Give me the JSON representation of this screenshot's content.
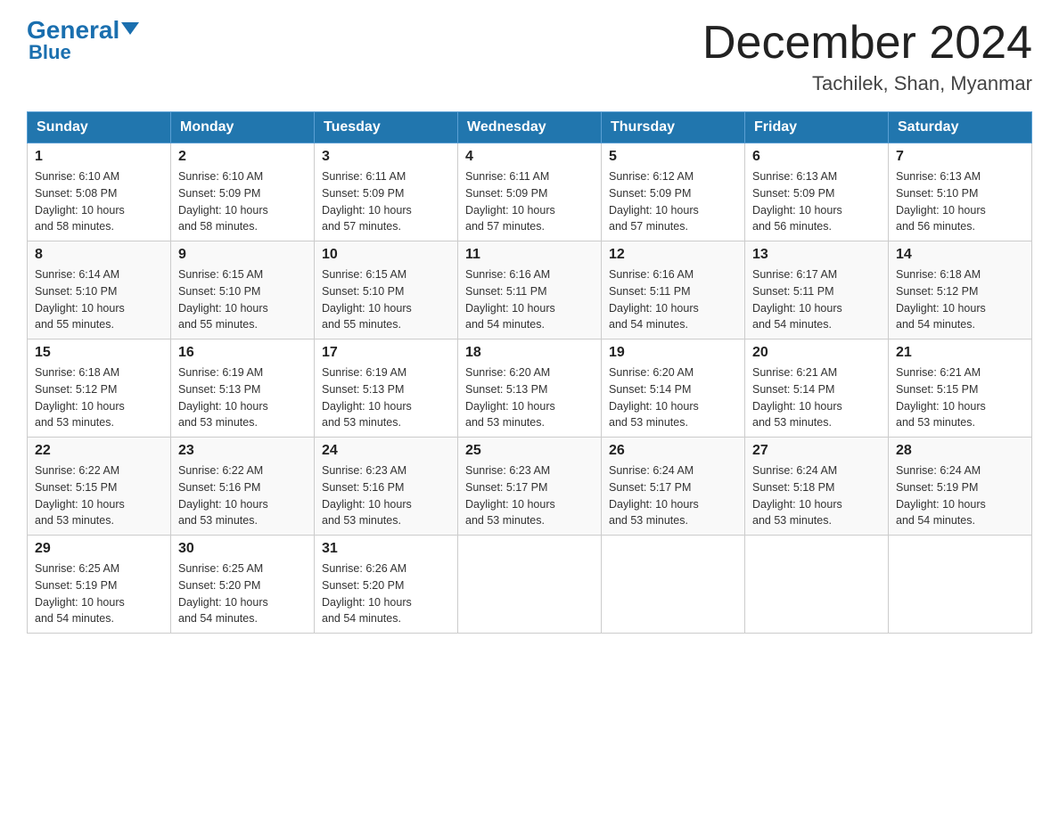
{
  "header": {
    "logo_general": "General",
    "logo_blue": "Blue",
    "month_title": "December 2024",
    "location": "Tachilek, Shan, Myanmar"
  },
  "days_of_week": [
    "Sunday",
    "Monday",
    "Tuesday",
    "Wednesday",
    "Thursday",
    "Friday",
    "Saturday"
  ],
  "weeks": [
    [
      {
        "num": "1",
        "sunrise": "6:10 AM",
        "sunset": "5:08 PM",
        "daylight": "10 hours and 58 minutes."
      },
      {
        "num": "2",
        "sunrise": "6:10 AM",
        "sunset": "5:09 PM",
        "daylight": "10 hours and 58 minutes."
      },
      {
        "num": "3",
        "sunrise": "6:11 AM",
        "sunset": "5:09 PM",
        "daylight": "10 hours and 57 minutes."
      },
      {
        "num": "4",
        "sunrise": "6:11 AM",
        "sunset": "5:09 PM",
        "daylight": "10 hours and 57 minutes."
      },
      {
        "num": "5",
        "sunrise": "6:12 AM",
        "sunset": "5:09 PM",
        "daylight": "10 hours and 57 minutes."
      },
      {
        "num": "6",
        "sunrise": "6:13 AM",
        "sunset": "5:09 PM",
        "daylight": "10 hours and 56 minutes."
      },
      {
        "num": "7",
        "sunrise": "6:13 AM",
        "sunset": "5:10 PM",
        "daylight": "10 hours and 56 minutes."
      }
    ],
    [
      {
        "num": "8",
        "sunrise": "6:14 AM",
        "sunset": "5:10 PM",
        "daylight": "10 hours and 55 minutes."
      },
      {
        "num": "9",
        "sunrise": "6:15 AM",
        "sunset": "5:10 PM",
        "daylight": "10 hours and 55 minutes."
      },
      {
        "num": "10",
        "sunrise": "6:15 AM",
        "sunset": "5:10 PM",
        "daylight": "10 hours and 55 minutes."
      },
      {
        "num": "11",
        "sunrise": "6:16 AM",
        "sunset": "5:11 PM",
        "daylight": "10 hours and 54 minutes."
      },
      {
        "num": "12",
        "sunrise": "6:16 AM",
        "sunset": "5:11 PM",
        "daylight": "10 hours and 54 minutes."
      },
      {
        "num": "13",
        "sunrise": "6:17 AM",
        "sunset": "5:11 PM",
        "daylight": "10 hours and 54 minutes."
      },
      {
        "num": "14",
        "sunrise": "6:18 AM",
        "sunset": "5:12 PM",
        "daylight": "10 hours and 54 minutes."
      }
    ],
    [
      {
        "num": "15",
        "sunrise": "6:18 AM",
        "sunset": "5:12 PM",
        "daylight": "10 hours and 53 minutes."
      },
      {
        "num": "16",
        "sunrise": "6:19 AM",
        "sunset": "5:13 PM",
        "daylight": "10 hours and 53 minutes."
      },
      {
        "num": "17",
        "sunrise": "6:19 AM",
        "sunset": "5:13 PM",
        "daylight": "10 hours and 53 minutes."
      },
      {
        "num": "18",
        "sunrise": "6:20 AM",
        "sunset": "5:13 PM",
        "daylight": "10 hours and 53 minutes."
      },
      {
        "num": "19",
        "sunrise": "6:20 AM",
        "sunset": "5:14 PM",
        "daylight": "10 hours and 53 minutes."
      },
      {
        "num": "20",
        "sunrise": "6:21 AM",
        "sunset": "5:14 PM",
        "daylight": "10 hours and 53 minutes."
      },
      {
        "num": "21",
        "sunrise": "6:21 AM",
        "sunset": "5:15 PM",
        "daylight": "10 hours and 53 minutes."
      }
    ],
    [
      {
        "num": "22",
        "sunrise": "6:22 AM",
        "sunset": "5:15 PM",
        "daylight": "10 hours and 53 minutes."
      },
      {
        "num": "23",
        "sunrise": "6:22 AM",
        "sunset": "5:16 PM",
        "daylight": "10 hours and 53 minutes."
      },
      {
        "num": "24",
        "sunrise": "6:23 AM",
        "sunset": "5:16 PM",
        "daylight": "10 hours and 53 minutes."
      },
      {
        "num": "25",
        "sunrise": "6:23 AM",
        "sunset": "5:17 PM",
        "daylight": "10 hours and 53 minutes."
      },
      {
        "num": "26",
        "sunrise": "6:24 AM",
        "sunset": "5:17 PM",
        "daylight": "10 hours and 53 minutes."
      },
      {
        "num": "27",
        "sunrise": "6:24 AM",
        "sunset": "5:18 PM",
        "daylight": "10 hours and 53 minutes."
      },
      {
        "num": "28",
        "sunrise": "6:24 AM",
        "sunset": "5:19 PM",
        "daylight": "10 hours and 54 minutes."
      }
    ],
    [
      {
        "num": "29",
        "sunrise": "6:25 AM",
        "sunset": "5:19 PM",
        "daylight": "10 hours and 54 minutes."
      },
      {
        "num": "30",
        "sunrise": "6:25 AM",
        "sunset": "5:20 PM",
        "daylight": "10 hours and 54 minutes."
      },
      {
        "num": "31",
        "sunrise": "6:26 AM",
        "sunset": "5:20 PM",
        "daylight": "10 hours and 54 minutes."
      },
      null,
      null,
      null,
      null
    ]
  ],
  "labels": {
    "sunrise": "Sunrise:",
    "sunset": "Sunset:",
    "daylight": "Daylight:"
  }
}
